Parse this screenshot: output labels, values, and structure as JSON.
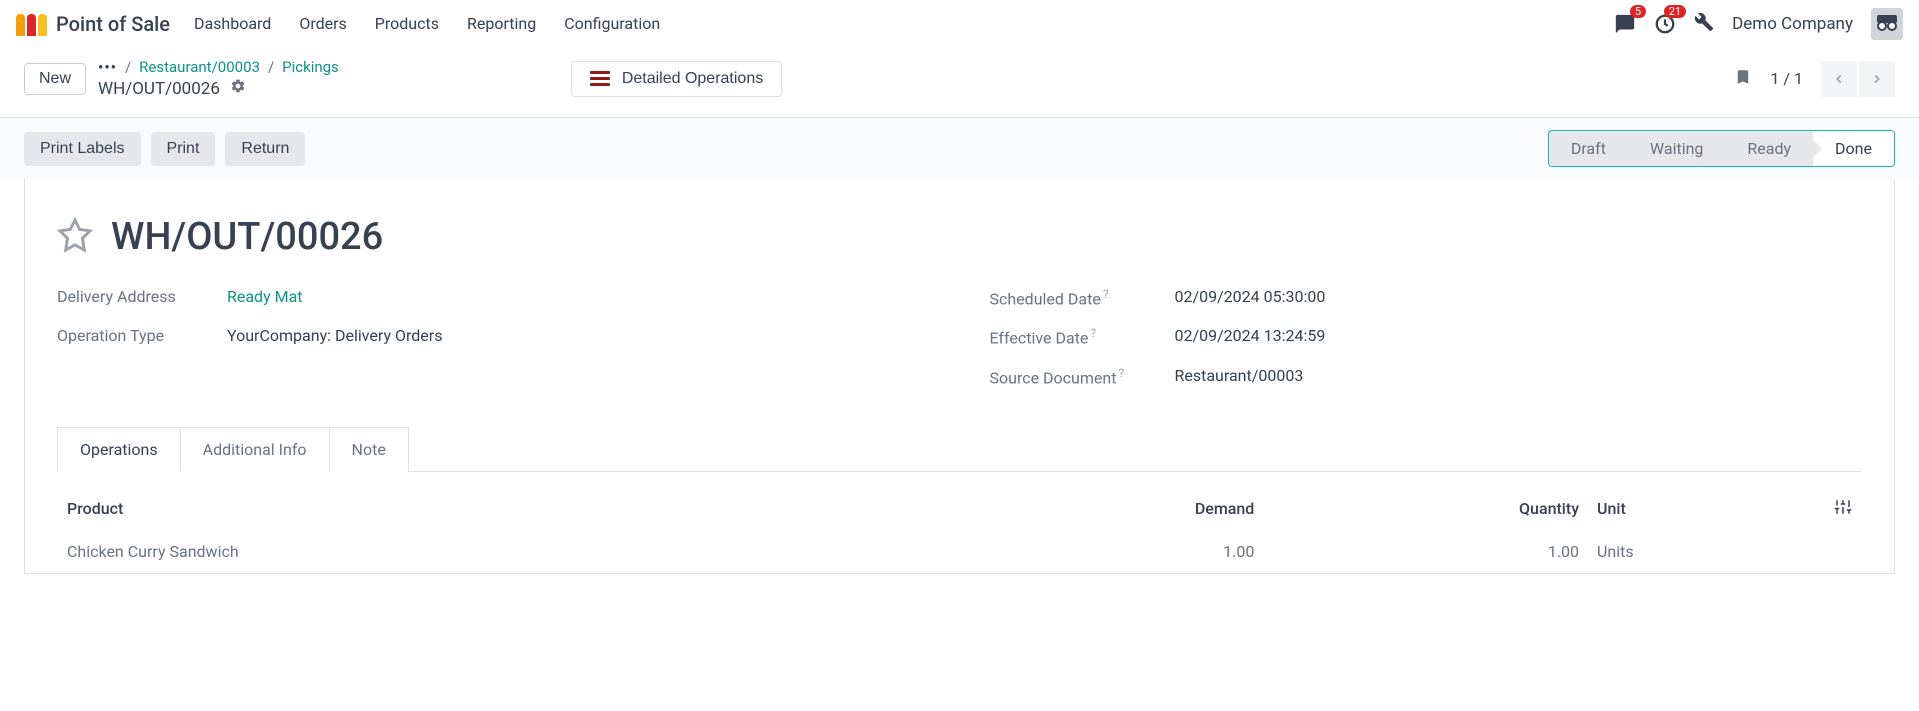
{
  "app": {
    "title": "Point of Sale"
  },
  "nav": {
    "items": [
      "Dashboard",
      "Orders",
      "Products",
      "Reporting",
      "Configuration"
    ],
    "messages_badge": "5",
    "activities_badge": "21",
    "company": "Demo Company"
  },
  "subheader": {
    "new_label": "New",
    "breadcrumb": {
      "root": "Restaurant/00003",
      "second": "Pickings"
    },
    "current": "WH/OUT/00026",
    "detailed_ops": "Detailed Operations",
    "pager": "1 / 1"
  },
  "actions": {
    "print_labels": "Print Labels",
    "print": "Print",
    "return": "Return"
  },
  "status": {
    "draft": "Draft",
    "waiting": "Waiting",
    "ready": "Ready",
    "done": "Done"
  },
  "record": {
    "title": "WH/OUT/00026",
    "labels": {
      "delivery_address": "Delivery Address",
      "operation_type": "Operation Type",
      "scheduled_date": "Scheduled Date",
      "effective_date": "Effective Date",
      "source_document": "Source Document"
    },
    "values": {
      "delivery_address": "Ready Mat",
      "operation_type": "YourCompany: Delivery Orders",
      "scheduled_date": "02/09/2024 05:30:00",
      "effective_date": "02/09/2024 13:24:59",
      "source_document": "Restaurant/00003"
    }
  },
  "tabs": {
    "operations": "Operations",
    "additional": "Additional Info",
    "note": "Note"
  },
  "table": {
    "headers": {
      "product": "Product",
      "demand": "Demand",
      "quantity": "Quantity",
      "unit": "Unit"
    },
    "rows": [
      {
        "product": "Chicken Curry Sandwich",
        "demand": "1.00",
        "quantity": "1.00",
        "unit": "Units"
      }
    ]
  }
}
